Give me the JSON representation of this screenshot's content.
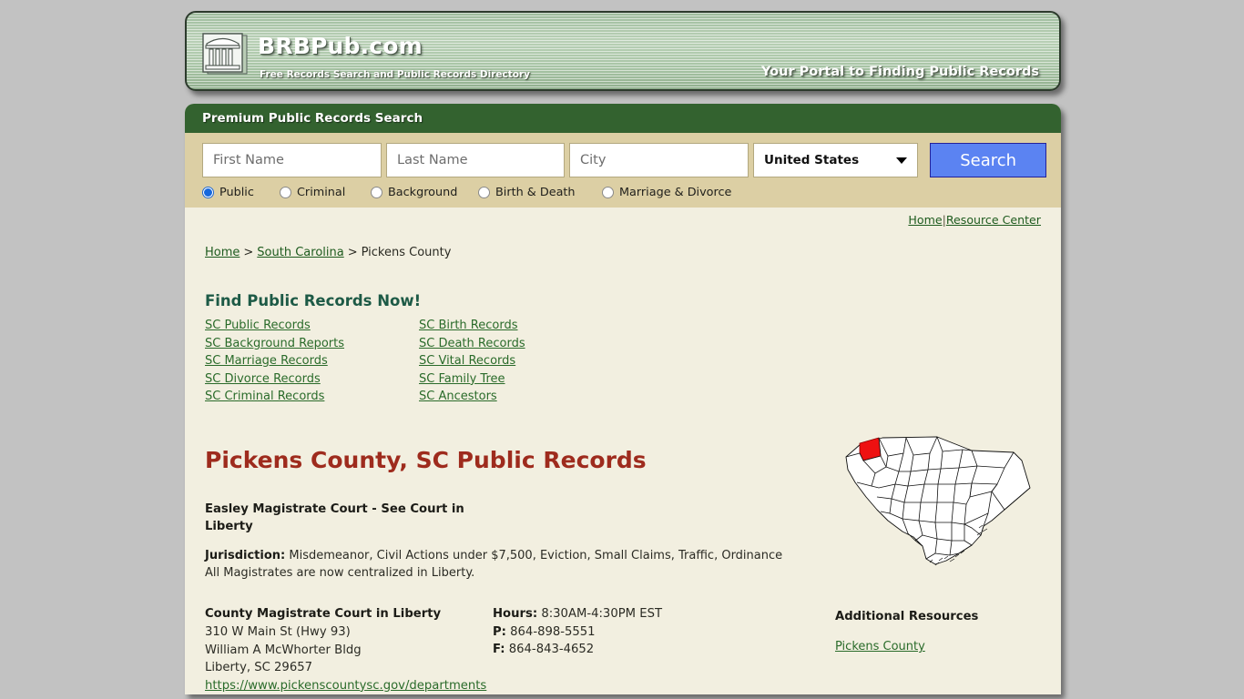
{
  "banner": {
    "logo_icon": "courthouse-building-icon",
    "brand": "BRBPub.com",
    "tagline_sub": "Free Records Search and Public Records Directory",
    "tagline_right": "Your Portal to Finding Public Records"
  },
  "search_panel": {
    "header": "Premium Public Records Search",
    "first_name": {
      "value": "",
      "placeholder": "First Name"
    },
    "last_name": {
      "value": "",
      "placeholder": "Last Name"
    },
    "city": {
      "value": "",
      "placeholder": "City"
    },
    "country": {
      "selected": "United States",
      "caret_icon": "chevron-down-icon"
    },
    "search_button": "Search",
    "record_types": [
      {
        "label": "Public",
        "selected": true
      },
      {
        "label": "Criminal",
        "selected": false
      },
      {
        "label": "Background",
        "selected": false
      },
      {
        "label": "Birth & Death",
        "selected": false
      },
      {
        "label": "Marriage & Divorce",
        "selected": false
      }
    ]
  },
  "toplinks": {
    "home": "Home",
    "divider": "|",
    "resource_center": "Resource Center"
  },
  "breadcrumb": {
    "home": "Home",
    "sep1": ">",
    "state": "South Carolina",
    "sep2": ">",
    "current": "Pickens County"
  },
  "find_records": {
    "title": "Find Public Records Now!",
    "column_left": [
      "SC Public Records",
      "SC Background Reports",
      "SC Marriage Records",
      "SC Divorce Records",
      "SC Criminal Records"
    ],
    "column_right": [
      "SC Birth Records",
      "SC Death Records",
      "SC Vital Records",
      "SC Family Tree",
      "SC Ancestors"
    ]
  },
  "page_title": "Pickens County, SC Public Records",
  "court": {
    "name": "Easley Magistrate Court - See Court in Liberty",
    "jurisdiction_label": "Jurisdiction:",
    "jurisdiction_value": "Misdemeanor, Civil Actions under $7,500, Eviction, Small Claims, Traffic, Ordinance",
    "note": "All Magistrates are now centralized in Liberty."
  },
  "office": {
    "name": "County Magistrate Court in Liberty",
    "address1": "310 W Main St (Hwy 93)",
    "address2": "William A McWhorter Bldg",
    "address3": "Liberty, SC 29657",
    "url": "https://www.pickenscountysc.gov/departments",
    "hours_label": "Hours:",
    "hours_value": "8:30AM-4:30PM EST",
    "phone_label": "P:",
    "phone_value": "864-898-5551",
    "fax_label": "F:",
    "fax_value": "864-843-4652"
  },
  "rail": {
    "map_icon": "south-carolina-county-map",
    "map_alt": "South Carolina counties map with Pickens County highlighted in red",
    "highlight_color": "#ee1111",
    "heading": "Additional Resources",
    "link": "Pickens County"
  },
  "colors": {
    "page_bg": "#c2c2c2",
    "card_bg": "#f2efe0",
    "header_green": "#33622f",
    "search_strip": "#dccfa4",
    "title_red": "#9e2b1d",
    "link_green": "#2a6b2a",
    "button_blue": "#5b83f2"
  }
}
